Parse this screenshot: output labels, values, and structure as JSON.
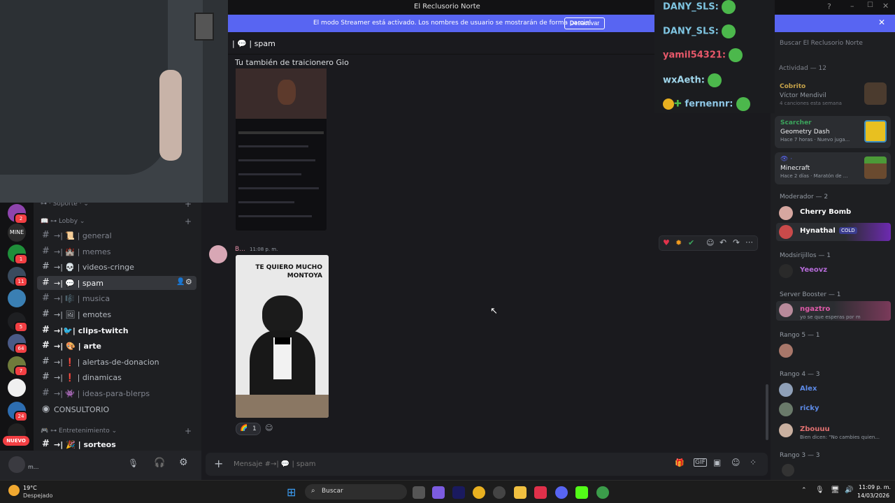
{
  "window": {
    "title": "El Reclusorio Norte"
  },
  "streamer_banner": {
    "text": "El modo Streamer está activado. Los nombres de usuario se mostrarán de forma parcial.",
    "button": "Desactivar"
  },
  "channel_header": {
    "name": "spam"
  },
  "server_badges": [
    "2",
    "",
    "1",
    "11",
    "",
    "5",
    "64",
    "7",
    "",
    "24",
    ""
  ],
  "new_pill": "NUEVO",
  "sidebar": {
    "categories": [
      {
        "label": "· Soporte ·"
      },
      {
        "label": "Lobby"
      },
      {
        "label": "Entretenimiento"
      }
    ],
    "channels": [
      {
        "label": "general",
        "state": "muted"
      },
      {
        "label": "memes",
        "state": "muted"
      },
      {
        "label": "videos-cringe",
        "state": "normal"
      },
      {
        "label": "spam",
        "state": "active"
      },
      {
        "label": "musica",
        "state": "muted"
      },
      {
        "label": "emotes",
        "state": "normal"
      },
      {
        "label": "clips-twitch",
        "state": "bright"
      },
      {
        "label": "arte",
        "state": "bright"
      },
      {
        "label": "alertas-de-donacion",
        "state": "normal"
      },
      {
        "label": "dinamicas",
        "state": "normal"
      },
      {
        "label": "ideas-para-blerps",
        "state": "muted"
      },
      {
        "label": "CONSULTORIO",
        "state": "voice"
      },
      {
        "label": "sorteos",
        "state": "bright"
      }
    ]
  },
  "user": {
    "name": "m..."
  },
  "messages": {
    "first": {
      "text": "Tu también de traicionero Gio"
    },
    "second": {
      "author": "B...",
      "time": "11:08 p. m.",
      "image_caption": "TE QUIERO MUCHO MONTOYA",
      "reaction_count": "1"
    }
  },
  "composer": {
    "placeholder": "Mensaje #→| 💬 | spam"
  },
  "members": {
    "search_placeholder": "Buscar El Reclusorio Norte",
    "activity_header": "Actividad — 12",
    "activity": [
      {
        "user": "Cobrito",
        "title": "Víctor Mendivil",
        "sub": "4 canciones esta semana"
      },
      {
        "user": "Scarcher",
        "title": "Geometry Dash",
        "sub": "Hace 7 horas · Nuevo juga..."
      },
      {
        "user": "",
        "title": "Minecraft",
        "sub": "Hace 2 días · Maratón de ..."
      }
    ],
    "groups": [
      {
        "header": "Moderador — 2",
        "members": [
          {
            "name": "Cherry Bomb",
            "color": "#ffffff",
            "sub": ""
          },
          {
            "name": "Hynathal",
            "color": "#ffffff",
            "sub": "COLD"
          }
        ]
      },
      {
        "header": "Modsirijillos — 1",
        "members": [
          {
            "name": "Yeeovz",
            "color": "#b56bd8",
            "sub": ""
          }
        ]
      },
      {
        "header": "Server Booster — 1",
        "members": [
          {
            "name": "ngaztro",
            "color": "#e05aa9",
            "sub": "yo se que esperas por m"
          }
        ]
      },
      {
        "header": "Rango 5 — 1",
        "members": [
          {
            "name": "",
            "color": "#ffffff",
            "sub": ""
          }
        ]
      },
      {
        "header": "Rango 4 — 3",
        "members": [
          {
            "name": "Alex",
            "color": "#5d8be8",
            "sub": ""
          },
          {
            "name": "ricky",
            "color": "#5d8be8",
            "sub": ""
          },
          {
            "name": "Zbouuu",
            "color": "#e07070",
            "sub": "Bien dicen: \"No cambies quien..."
          }
        ]
      },
      {
        "header": "Rango 3 — 3",
        "members": []
      }
    ]
  },
  "chat_overlay": [
    {
      "name": "DANY_SLS:",
      "color": "#7ec4e0"
    },
    {
      "name": "DANY_SLS:",
      "color": "#7ec4e0"
    },
    {
      "name": "yamil54321:",
      "color": "#e8586a"
    },
    {
      "name": "wxAeth:",
      "color": "#9fd5ea"
    },
    {
      "name": "fernennr:",
      "color": "#8fc7e6"
    }
  ],
  "taskbar": {
    "weather_temp": "19°C",
    "weather_desc": "Despejado",
    "search": "Buscar",
    "time": "11:09 p. m.",
    "date": "14/03/2026"
  }
}
